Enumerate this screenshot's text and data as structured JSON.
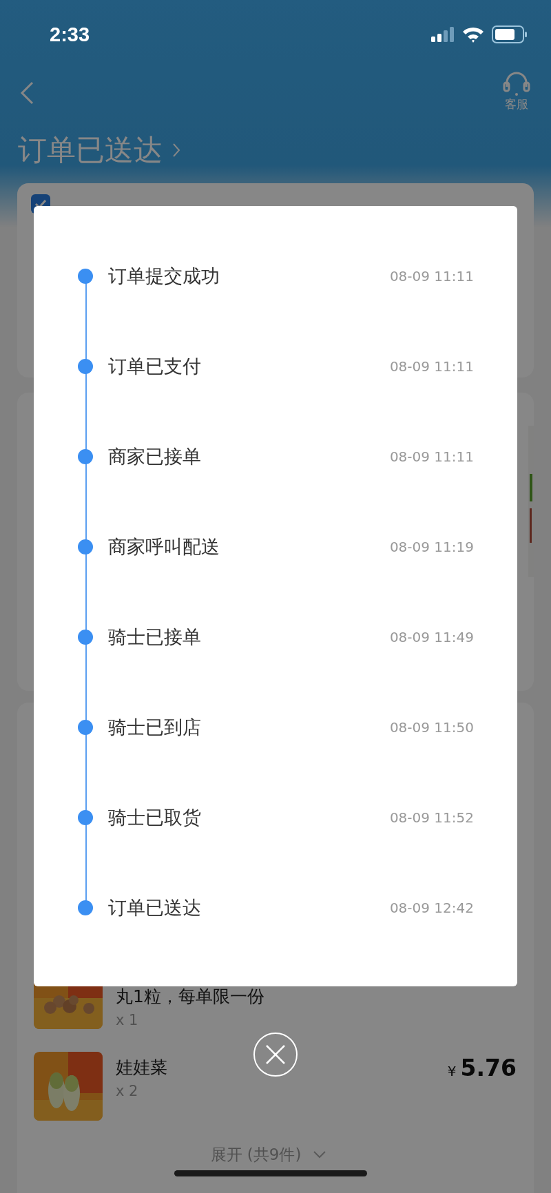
{
  "status_bar": {
    "time": "2:33"
  },
  "header": {
    "service_label": "客服",
    "title": "订单已送达"
  },
  "timeline": [
    {
      "label": "订单提交成功",
      "time": "08-09 11:11"
    },
    {
      "label": "订单已支付",
      "time": "08-09 11:11"
    },
    {
      "label": "商家已接单",
      "time": "08-09 11:11"
    },
    {
      "label": "商家呼叫配送",
      "time": "08-09 11:19"
    },
    {
      "label": "骑士已接单",
      "time": "08-09 11:49"
    },
    {
      "label": "骑士已到店",
      "time": "08-09 11:50"
    },
    {
      "label": "骑士已取货",
      "time": "08-09 11:52"
    },
    {
      "label": "订单已送达",
      "time": "08-09 12:42"
    }
  ],
  "products": [
    {
      "kind": "meatballs",
      "name": "丸1粒，每单限一份",
      "quantity": "x 1"
    },
    {
      "kind": "cabbage",
      "name": "娃娃菜",
      "quantity": "x 2",
      "currency": "¥",
      "price": "5.76"
    }
  ],
  "expand_label": "展开 (共9件)"
}
